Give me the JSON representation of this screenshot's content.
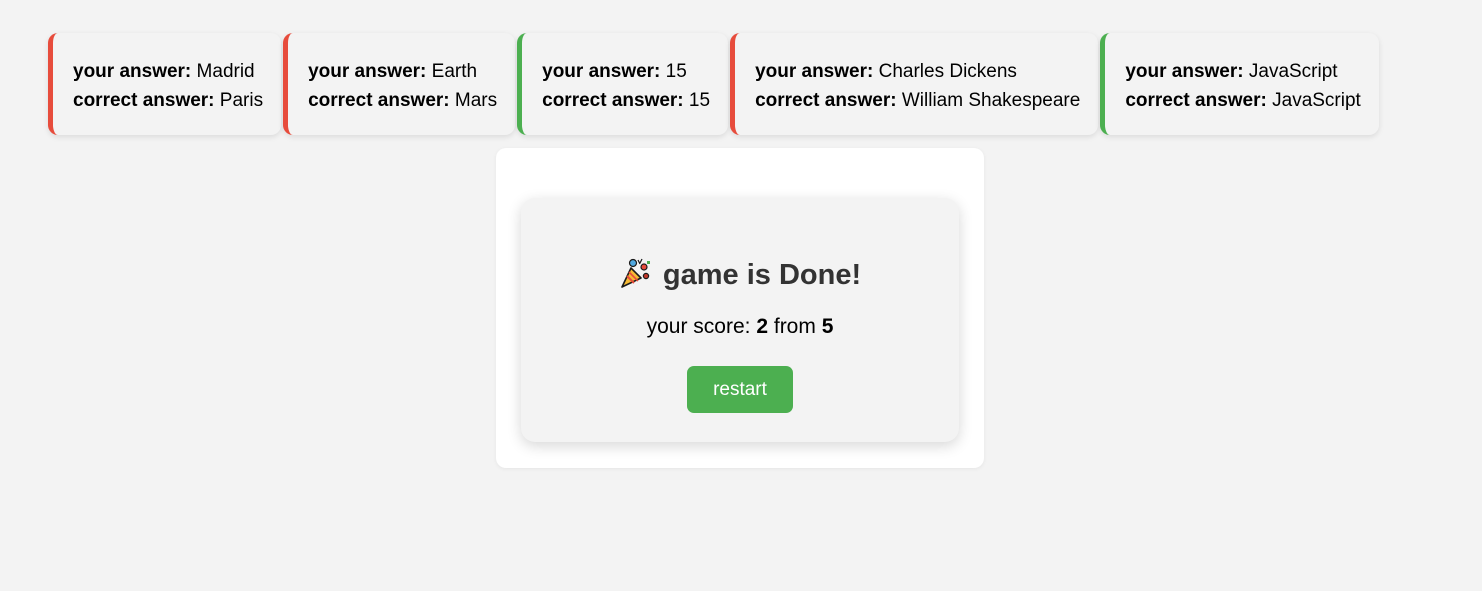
{
  "answers": {
    "your_label": "your answer:",
    "correct_label": "correct answer:",
    "items": [
      {
        "your": "Madrid",
        "correct": "Paris",
        "status": "wrong"
      },
      {
        "your": "Earth",
        "correct": "Mars",
        "status": "wrong"
      },
      {
        "your": "15",
        "correct": "15",
        "status": "correct"
      },
      {
        "your": "Charles Dickens",
        "correct": "William Shakespeare",
        "status": "wrong"
      },
      {
        "your": "JavaScript",
        "correct": "JavaScript",
        "status": "correct"
      }
    ]
  },
  "result": {
    "title": "game is Done!",
    "icon": "party-popper-icon",
    "score_prefix": "your score:",
    "score": "2",
    "score_joiner": "from",
    "total": "5",
    "restart_label": "restart"
  },
  "colors": {
    "correct": "#4caf50",
    "wrong": "#e74c3c",
    "button": "#4caf50"
  }
}
